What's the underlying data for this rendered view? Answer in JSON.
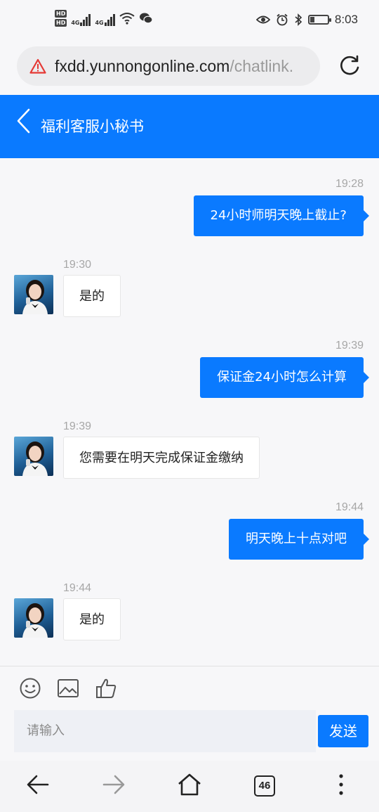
{
  "status_bar": {
    "network_badges": [
      "HD",
      "HD"
    ],
    "signal_labels": [
      "4G",
      "4G"
    ],
    "time": "8:03",
    "battery_level": 0.25,
    "icons": [
      "wifi-icon",
      "wechat-icon",
      "eye-icon",
      "alarm-icon",
      "bluetooth-icon",
      "battery-icon"
    ]
  },
  "browser": {
    "url_host": "fxdd.yunnongonline.com",
    "url_path": "/chatlink.",
    "warning_icon": "warning-triangle-icon",
    "reload_icon": "reload-icon"
  },
  "header": {
    "title": "福利客服小秘书",
    "back_icon": "chevron-left-icon"
  },
  "messages": [
    {
      "direction": "out",
      "time": "19:28",
      "text": "24小时师明天晚上截止?"
    },
    {
      "direction": "in",
      "time": "19:30",
      "text": "是的"
    },
    {
      "direction": "out",
      "time": "19:39",
      "text": "保证金24小时怎么计算"
    },
    {
      "direction": "in",
      "time": "19:39",
      "text": "您需要在明天完成保证金缴纳"
    },
    {
      "direction": "out",
      "time": "19:44",
      "text": "明天晚上十点对吧"
    },
    {
      "direction": "in",
      "time": "19:44",
      "text": "是的"
    }
  ],
  "composer": {
    "tools": [
      "smiley-icon",
      "image-icon",
      "thumbs-up-icon"
    ],
    "placeholder": "请输入",
    "send_label": "发送"
  },
  "bottom_nav": {
    "items": [
      "back-arrow-icon",
      "forward-arrow-icon",
      "home-icon",
      "tabs-icon",
      "more-icon"
    ],
    "tab_count": "46"
  },
  "colors": {
    "accent": "#0a7aff",
    "warning": "#e53935"
  }
}
